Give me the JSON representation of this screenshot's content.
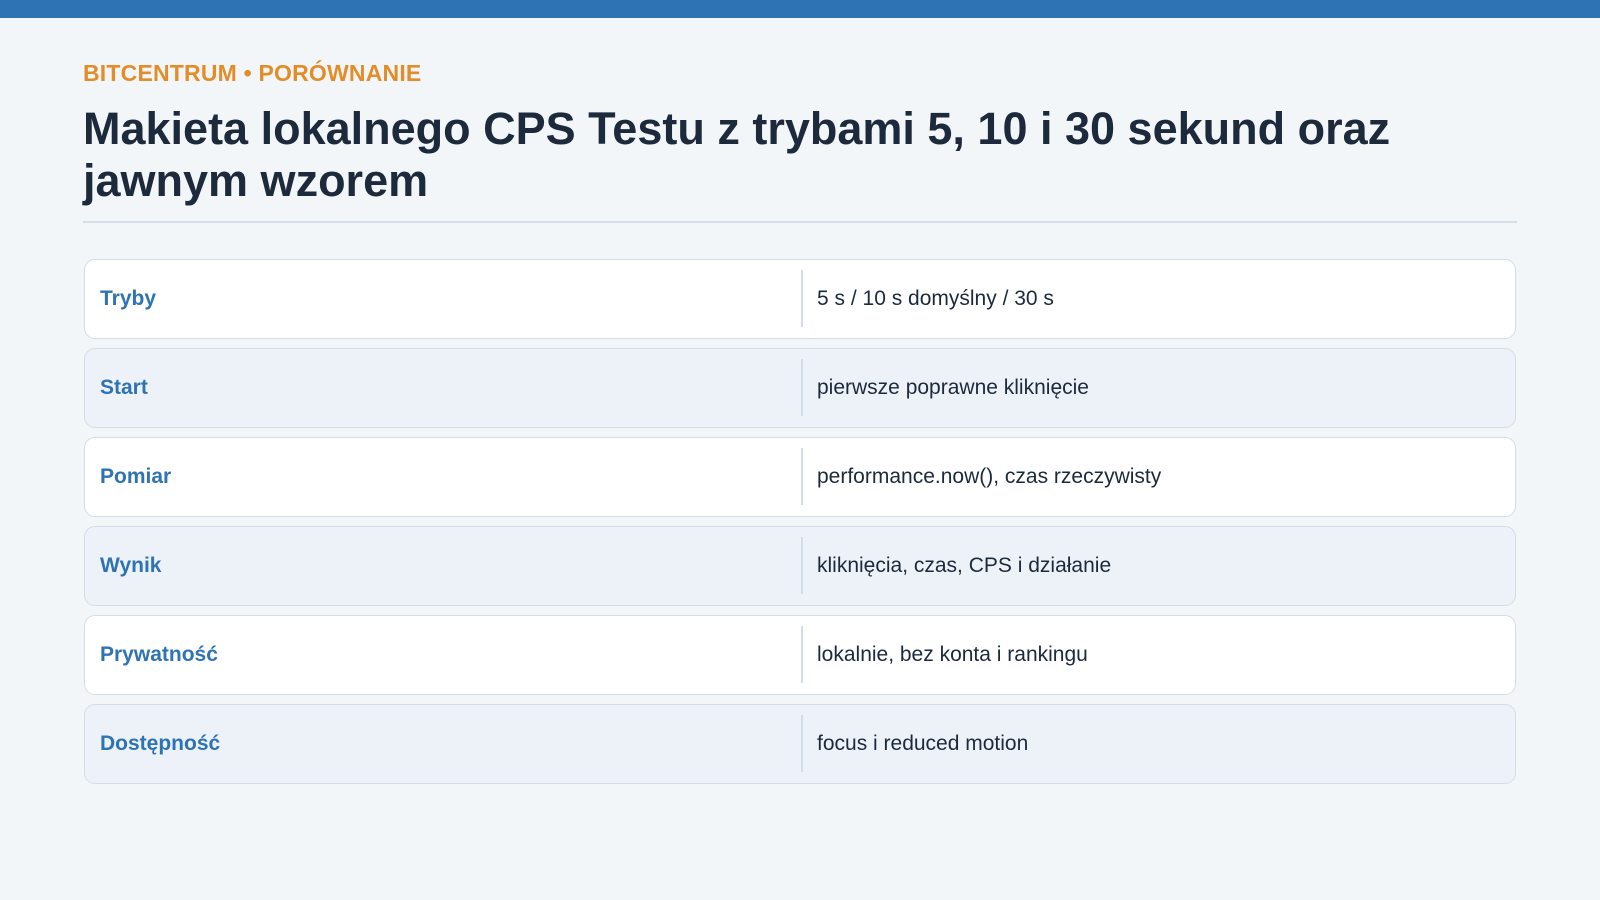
{
  "header": {
    "eyebrow": "BITCENTRUM • PORÓWNANIE",
    "title": "Makieta lokalnego CPS Testu z trybami 5, 10 i 30 sekund oraz jawnym wzorem"
  },
  "comparison": {
    "rows": [
      {
        "label": "Tryby",
        "value": "5 s / 10 s domyślny / 30 s"
      },
      {
        "label": "Start",
        "value": "pierwsze poprawne kliknięcie"
      },
      {
        "label": "Pomiar",
        "value": "performance.now(), czas rzeczywisty"
      },
      {
        "label": "Wynik",
        "value": "kliknięcia, czas, CPS i działanie"
      },
      {
        "label": "Prywatność",
        "value": "lokalnie, bez konta i rankingu"
      },
      {
        "label": "Dostępność",
        "value": "focus i reduced motion"
      }
    ]
  },
  "colors": {
    "accent": "#2e73b4",
    "eyebrow": "#e38d2a",
    "text": "#1c2a3c",
    "background": "#f3f6f9"
  }
}
